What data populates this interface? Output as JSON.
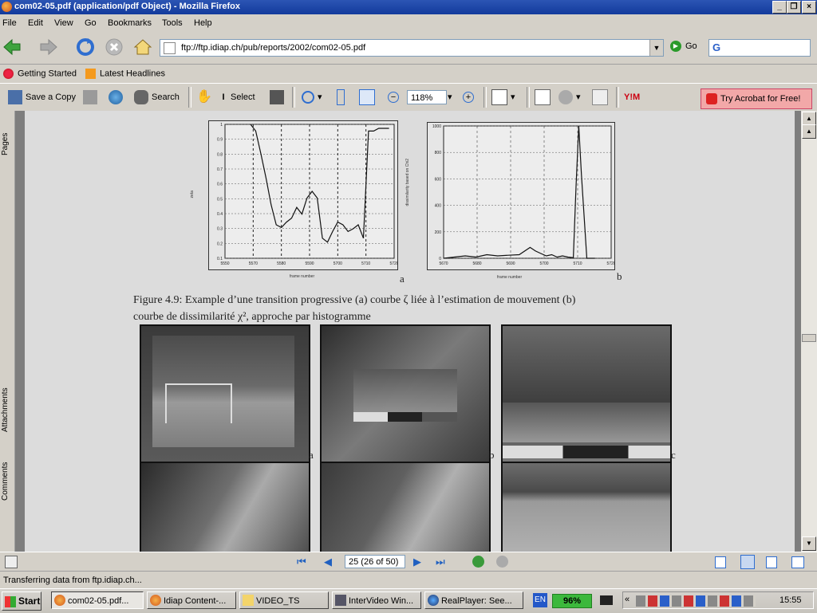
{
  "window": {
    "title": "com02-05.pdf (application/pdf Object) - Mozilla Firefox",
    "controls": [
      "_",
      "❒",
      "×"
    ]
  },
  "menu": [
    "File",
    "Edit",
    "View",
    "Go",
    "Bookmarks",
    "Tools",
    "Help"
  ],
  "nav": {
    "url": "ftp://ftp.idiap.ch/pub/reports/2002/com02-05.pdf",
    "go_label": "Go",
    "search_logo": "G"
  },
  "bookmarks": [
    {
      "label": "Getting Started",
      "icon": "firefox-icon"
    },
    {
      "label": "Latest Headlines",
      "icon": "rss-icon"
    }
  ],
  "acrobat": {
    "save_copy": "Save a Copy",
    "search": "Search",
    "select": "Select",
    "zoom": "118%",
    "try_acrobat": "Try Acrobat for Free!"
  },
  "side_tabs": {
    "pages": "Pages",
    "attachments": "Attachments",
    "comments": "Comments"
  },
  "figure": {
    "plot_a_label": "a",
    "plot_b_label": "b",
    "plot_a_xlabel": "frame number",
    "plot_b_xlabel": "frame number",
    "plot_a_ylabel": "zeta",
    "plot_b_ylabel": "dissimilarity based on Chi2",
    "plot_a_xticks": [
      "5550",
      "5570",
      "5580",
      "5590",
      "5700",
      "5710",
      "5720"
    ],
    "plot_b_xticks": [
      "5670",
      "5680",
      "5690",
      "5700",
      "5710",
      "5720"
    ],
    "plot_a_yticks": [
      "1",
      "0.9",
      "0.8",
      "0.7",
      "0.6",
      "0.5",
      "0.4",
      "0.3",
      "0.2",
      "0.1"
    ],
    "plot_b_yticks": [
      "1000",
      "800",
      "600",
      "400",
      "200",
      "0"
    ],
    "caption_line1": "Figure 4.9: Example d’une transition progressive (a) courbe ζ liée à l’estimation de mouvement (b)",
    "caption_line2": "courbe de dissimilarité χ², approche par histogramme",
    "thumb_labels": [
      "a",
      "b",
      "c"
    ]
  },
  "chart_data": [
    {
      "type": "line",
      "title": "",
      "xlabel": "frame number",
      "ylabel": "zeta",
      "ylim": [
        0,
        1
      ],
      "xlim": [
        5660,
        5726
      ],
      "x": [
        5670,
        5672,
        5674,
        5676,
        5678,
        5680,
        5682,
        5684,
        5686,
        5688,
        5690,
        5692,
        5694,
        5696,
        5698,
        5700,
        5702,
        5704,
        5706,
        5708,
        5710,
        5712,
        5714,
        5716,
        5718,
        5720,
        5724
      ],
      "series": [
        {
          "values": [
            1.0,
            0.95,
            0.78,
            0.6,
            0.4,
            0.25,
            0.23,
            0.27,
            0.3,
            0.38,
            0.33,
            0.45,
            0.5,
            0.45,
            0.15,
            0.12,
            0.2,
            0.27,
            0.25,
            0.2,
            0.22,
            0.25,
            0.15,
            0.95,
            0.95,
            0.97,
            0.97
          ]
        }
      ]
    },
    {
      "type": "line",
      "title": "",
      "xlabel": "frame number",
      "ylabel": "dissimilarity based on Chi2",
      "ylim": [
        0,
        1100
      ],
      "xlim": [
        5664,
        5726
      ],
      "x": [
        5664,
        5668,
        5672,
        5676,
        5680,
        5684,
        5688,
        5692,
        5696,
        5698,
        5700,
        5702,
        5704,
        5706,
        5708,
        5710,
        5712,
        5713,
        5714,
        5715,
        5716,
        5717,
        5720
      ],
      "series": [
        {
          "values": [
            0,
            10,
            20,
            10,
            30,
            20,
            25,
            30,
            90,
            60,
            40,
            20,
            30,
            10,
            20,
            10,
            5,
            600,
            1100,
            700,
            350,
            0,
            0
          ]
        }
      ]
    }
  ],
  "page_nav": {
    "page_field": "25 (26 of 50)"
  },
  "status": "Transferring data from ftp.idiap.ch...",
  "taskbar": {
    "start": "Start",
    "tasks": [
      "com02-05.pdf...",
      "Idiap Content-...",
      "VIDEO_TS",
      "InterVideo Win...",
      "RealPlayer: See..."
    ],
    "lang": "EN",
    "battery": "96%",
    "clock": "15:55"
  }
}
